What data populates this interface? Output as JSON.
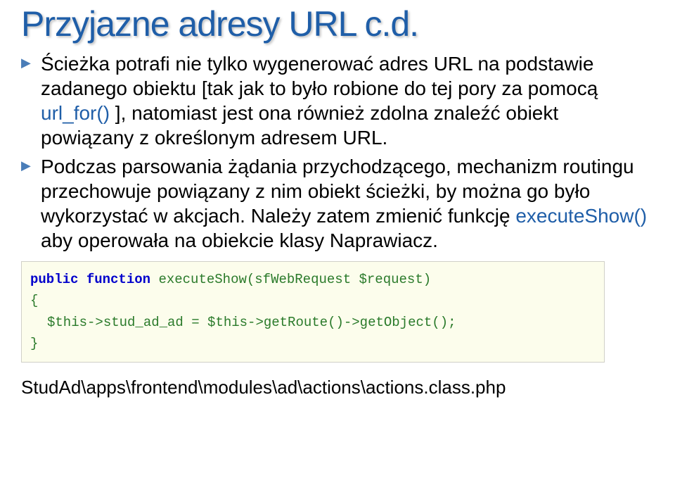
{
  "title": "Przyjazne adresy URL c.d.",
  "bullets": [
    {
      "prefix": "Ścieżka potrafi nie tylko wygenerować adres URL na podstawie zadanego obiektu [tak jak to było robione do tej pory za pomocą ",
      "highlight1": "url_for()",
      "suffix1": " ], natomiast jest ona również zdolna znaleźć obiekt powiązany z określonym adresem URL."
    },
    {
      "text": "Podczas parsowania żądania przychodzącego, mechanizm routingu przechowuje powiązany z nim obiekt ścieżki, by można go było wykorzystać w akcjach. Należy zatem zmienić funkcję ",
      "highlight": "executeShow()",
      "suffix": " aby operowała na obiekcie klasy Naprawiacz."
    }
  ],
  "code": {
    "kw1": "public",
    "kw2": "function",
    "fn": "executeShow(sfWebRequest $request)",
    "brace_open": "{",
    "body": "$this->stud_ad_ad = $this->getRoute()->getObject();",
    "brace_close": "}"
  },
  "path": "StudAd\\apps\\frontend\\modules\\ad\\actions\\actions.class.php"
}
